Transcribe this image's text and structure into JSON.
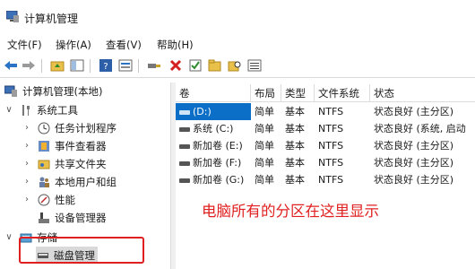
{
  "window": {
    "title": "计算机管理"
  },
  "menu": [
    "文件(F)",
    "操作(A)",
    "查看(V)",
    "帮助(H)"
  ],
  "toolbar": {
    "icons": [
      "back-arrow-icon",
      "forward-arrow-icon",
      "up-folder-icon",
      "show-hide-tree-icon",
      "help-icon",
      "properties-icon",
      "connect-icon",
      "delete-icon",
      "check-icon",
      "folder-icon",
      "search-folder-icon",
      "list-view-icon"
    ],
    "delete_color": "#d42020"
  },
  "tree": {
    "root": "计算机管理(本地)",
    "system_tools": "系统工具",
    "task_scheduler": "任务计划程序",
    "event_viewer": "事件查看器",
    "shared_folders": "共享文件夹",
    "local_users": "本地用户和组",
    "performance": "性能",
    "device_manager": "设备管理器",
    "storage": "存储",
    "disk_management": "磁盘管理"
  },
  "table": {
    "headers": [
      "卷",
      "布局",
      "类型",
      "文件系统",
      "状态"
    ],
    "rows": [
      [
        "(D:)",
        "简单",
        "基本",
        "NTFS",
        "状态良好 (主分区)"
      ],
      [
        "系统 (C:)",
        "简单",
        "基本",
        "NTFS",
        "状态良好 (系统, 启动"
      ],
      [
        "新加卷 (E:)",
        "简单",
        "基本",
        "NTFS",
        "状态良好 (主分区)"
      ],
      [
        "新加卷 (F:)",
        "简单",
        "基本",
        "NTFS",
        "状态良好 (主分区)"
      ],
      [
        "新加卷 (G:)",
        "简单",
        "基本",
        "NTFS",
        "状态良好 (主分区)"
      ]
    ]
  },
  "annotation": {
    "text": "电脑所有的分区在这里显示",
    "color": "#e02020"
  }
}
